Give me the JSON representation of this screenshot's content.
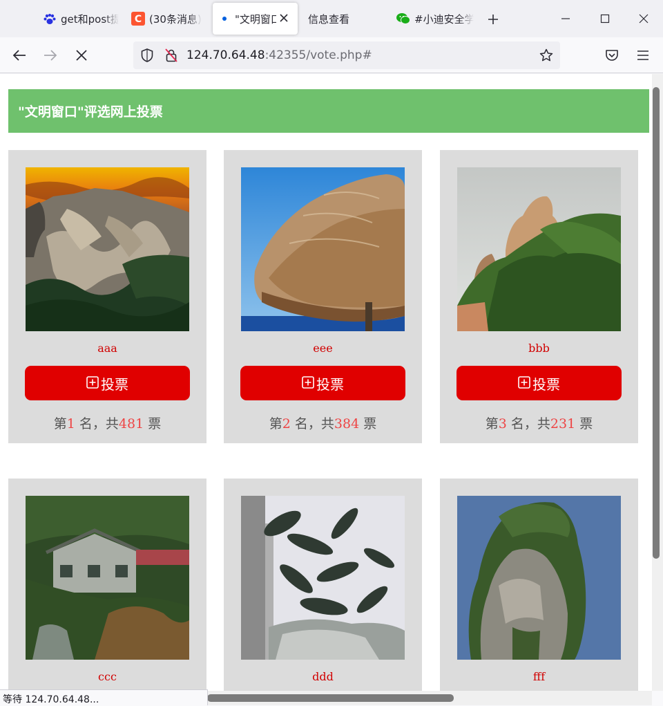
{
  "browser": {
    "tabs": [
      {
        "label": "get和post提",
        "icon": "baidu-paw-icon"
      },
      {
        "label": "(30条消息)",
        "icon": "csdn-icon"
      },
      {
        "label": "\"文明窗口\"",
        "icon": "loading-dot-icon",
        "active": true
      },
      {
        "label": "信息查看",
        "icon": ""
      },
      {
        "label": "#小迪安全学",
        "icon": "wechat-icon"
      }
    ],
    "url_host": "124.70.64.48",
    "url_rest": ":42355/vote.php#",
    "status": "等待 124.70.64.48..."
  },
  "page": {
    "title": "\"文明窗口\"评选网上投票",
    "vote_label": "投票",
    "rank_prefix": "第",
    "rank_mid": " 名，共",
    "rank_suffix": " 票",
    "candidates": [
      {
        "name": "aaa",
        "rank": "1",
        "votes": "481"
      },
      {
        "name": "eee",
        "rank": "2",
        "votes": "384"
      },
      {
        "name": "bbb",
        "rank": "3",
        "votes": "231"
      },
      {
        "name": "ccc"
      },
      {
        "name": "ddd"
      },
      {
        "name": "fff"
      }
    ]
  },
  "colors": {
    "banner": "#6fc16d",
    "vote_button": "#e00000",
    "card_bg": "#dcdcdc",
    "highlight_number": "#e44444"
  }
}
